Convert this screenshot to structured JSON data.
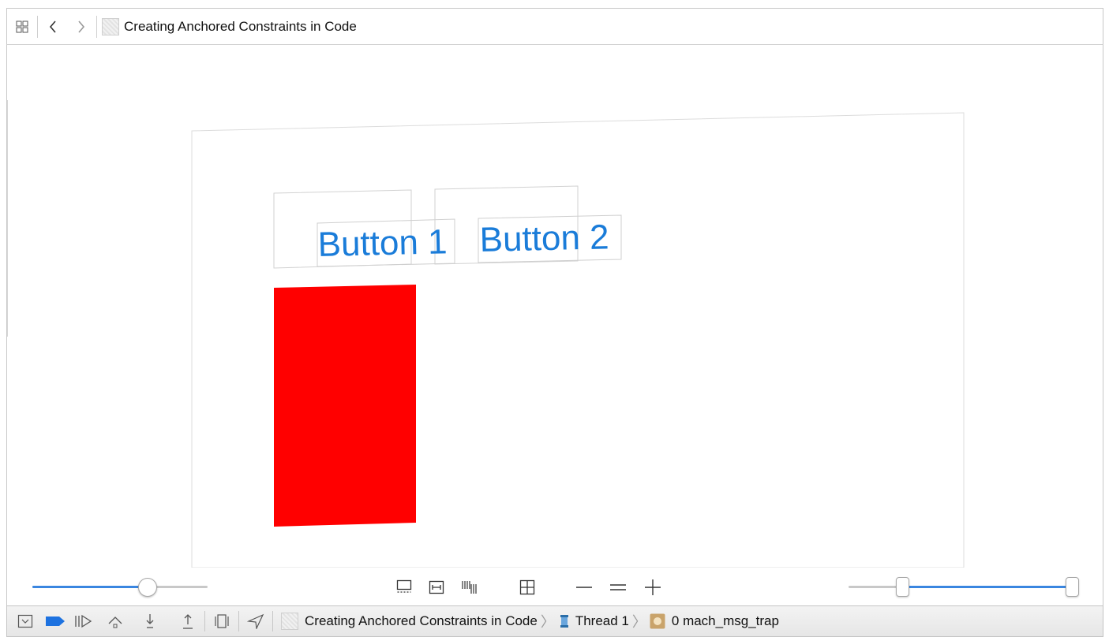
{
  "nav": {
    "title": "Creating Anchored Constraints in Code"
  },
  "canvas": {
    "button1_label": "Button 1",
    "button2_label": "Button 2",
    "accent_color": "#1a7cd9",
    "red_view_color": "#ff0000"
  },
  "controls": {
    "left_slider_value": 0.67,
    "right_slider_low": 0.26,
    "right_slider_high": 1.0,
    "accent_color": "#3a86e0"
  },
  "debugbar": {
    "crumbs": [
      "Creating Anchored Constraints in Code",
      "Thread 1",
      "0 mach_msg_trap"
    ],
    "icons": [
      "hide-debug-area-icon",
      "breakpoint-icon",
      "continue-icon",
      "step-over-icon",
      "step-into-icon",
      "step-out-icon",
      "view-debugger-icon",
      "location-icon"
    ]
  }
}
